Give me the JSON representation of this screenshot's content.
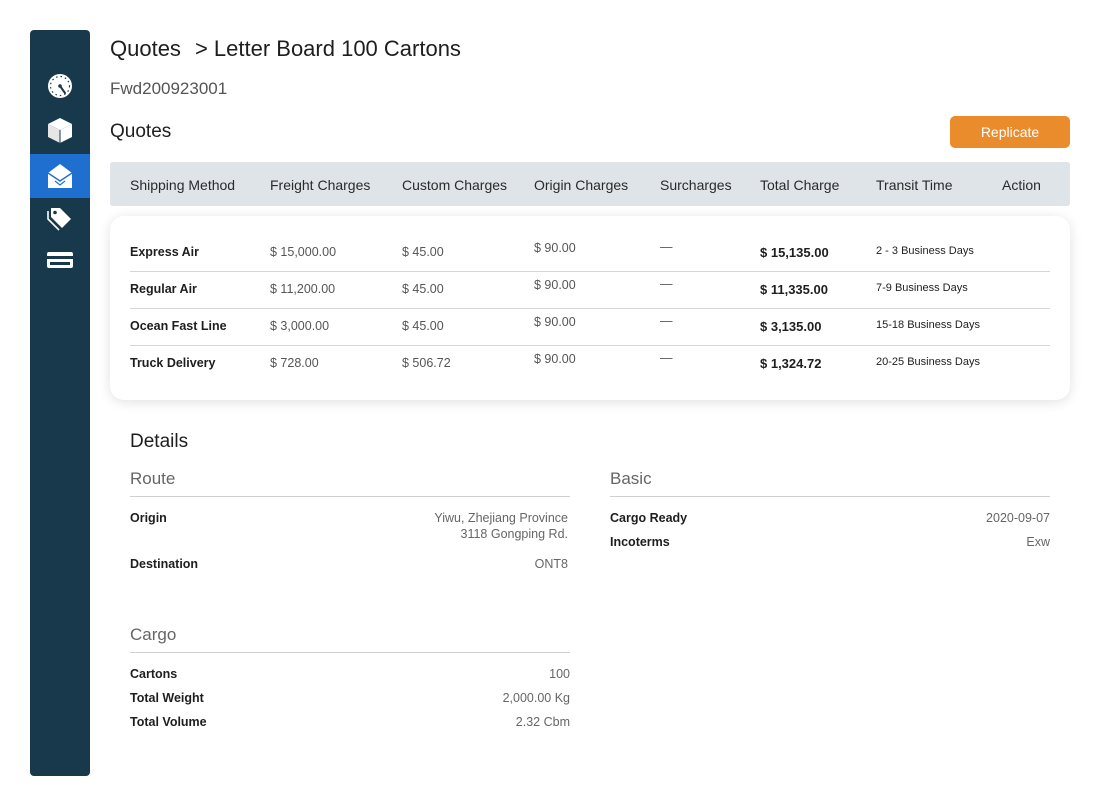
{
  "sidebar": {
    "items": [
      {
        "icon": "gauge-icon",
        "active": false
      },
      {
        "icon": "box-icon",
        "active": false
      },
      {
        "icon": "envelope-icon",
        "active": true
      },
      {
        "icon": "tags-icon",
        "active": false
      },
      {
        "icon": "card-icon",
        "active": false
      }
    ],
    "active_color": "#1f6fd1",
    "background": "#17394b"
  },
  "header": {
    "breadcrumb_root": "Quotes",
    "breadcrumb_current": "> Letter Board 100 Cartons",
    "reference": "Fwd200923001"
  },
  "quotes": {
    "title": "Quotes",
    "replicate_label": "Replicate",
    "accent_color": "#ea8c2c",
    "columns": [
      "Shipping Method",
      "Freight Charges",
      "Custom Charges",
      "Origin Charges",
      "Surcharges",
      "Total Charge",
      "Transit Time",
      "Action"
    ],
    "rows": [
      {
        "method": "Express Air",
        "freight": "$ 15,000.00",
        "custom": "$ 45.00",
        "origin": "$ 90.00",
        "surcharges": "—",
        "total": "$ 15,135.00",
        "transit": "2 - 3 Business Days"
      },
      {
        "method": "Regular Air",
        "freight": "$ 11,200.00",
        "custom": "$ 45.00",
        "origin": "$ 90.00",
        "surcharges": "—",
        "total": "$ 11,335.00",
        "transit": "7-9 Business Days"
      },
      {
        "method": "Ocean Fast Line",
        "freight": "$ 3,000.00",
        "custom": "$ 45.00",
        "origin": "$ 90.00",
        "surcharges": "—",
        "total": "$ 3,135.00",
        "transit": "15-18 Business Days"
      },
      {
        "method": "Truck Delivery",
        "freight": "$ 728.00",
        "custom": "$ 506.72",
        "origin": "$ 90.00",
        "surcharges": "—",
        "total": "$ 1,324.72",
        "transit": "20-25 Business Days"
      }
    ]
  },
  "details": {
    "title": "Details",
    "route": {
      "title": "Route",
      "origin_label": "Origin",
      "origin_line1": "Yiwu, Zhejiang Province",
      "origin_line2": "3118 Gongping Rd.",
      "destination_label": "Destination",
      "destination_value": "ONT8"
    },
    "basic": {
      "title": "Basic",
      "cargo_ready_label": "Cargo Ready",
      "cargo_ready_value": "2020-09-07",
      "incoterms_label": "Incoterms",
      "incoterms_value": "Exw"
    },
    "cargo": {
      "title": "Cargo",
      "cartons_label": "Cartons",
      "cartons_value": "100",
      "weight_label": "Total Weight",
      "weight_value": "2,000.00 Kg",
      "volume_label": "Total Volume",
      "volume_value": "2.32 Cbm"
    }
  }
}
